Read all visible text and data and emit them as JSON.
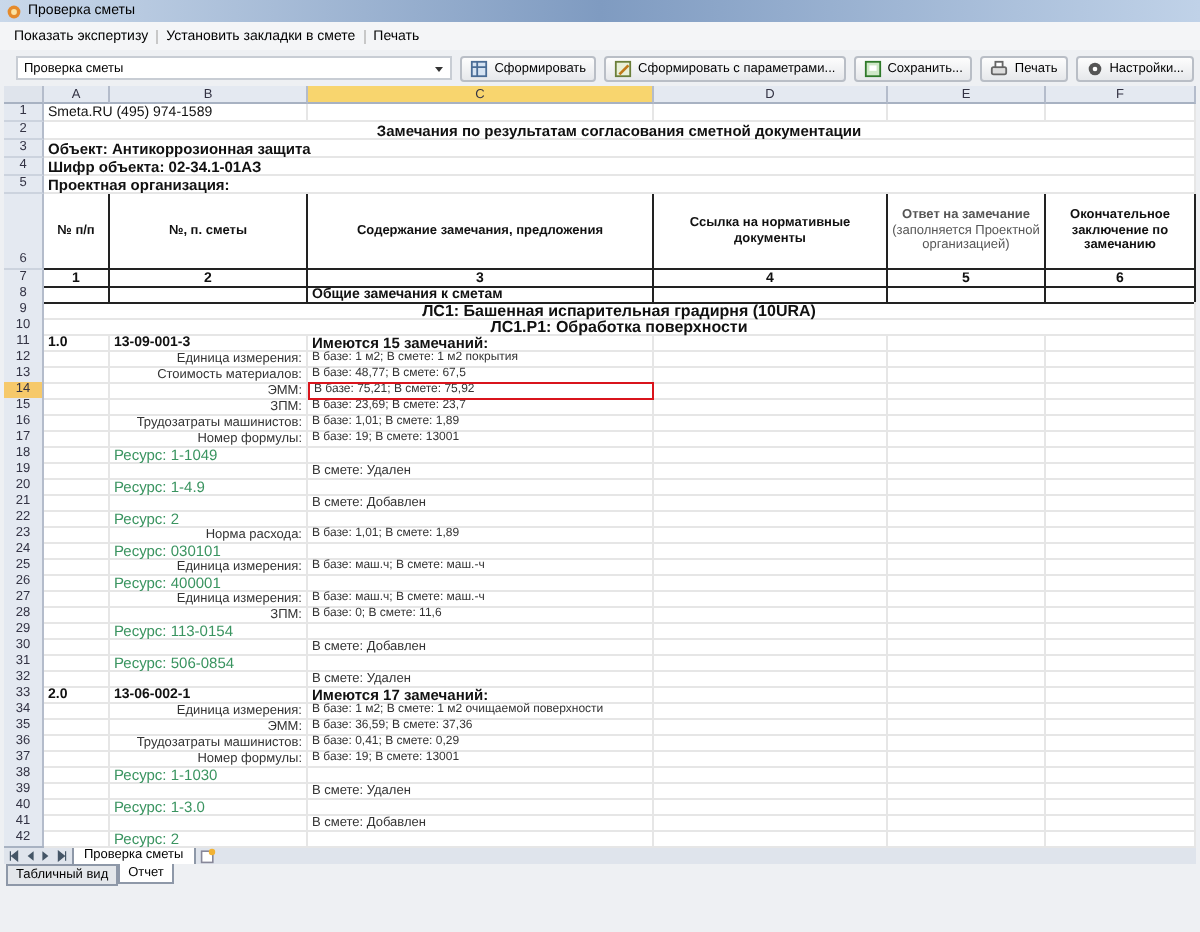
{
  "window": {
    "title": "Проверка сметы"
  },
  "menu": [
    "Показать экспертизу",
    "Установить закладки в смете",
    "Печать"
  ],
  "toolbar": {
    "report_select": "Проверка сметы",
    "buttons": [
      {
        "label": "Сформировать",
        "kind": "table"
      },
      {
        "label": "Сформировать с параметрами...",
        "kind": "params"
      },
      {
        "label": "Сохранить...",
        "kind": "save"
      },
      {
        "label": "Печать",
        "kind": "print"
      },
      {
        "label": "Настройки...",
        "kind": "settings"
      }
    ]
  },
  "columns": [
    {
      "label": "A",
      "selected": false
    },
    {
      "label": "B",
      "selected": false
    },
    {
      "label": "C",
      "selected": true
    },
    {
      "label": "D",
      "selected": false
    },
    {
      "label": "E",
      "selected": false
    },
    {
      "label": "F",
      "selected": false
    }
  ],
  "rows": [
    {
      "num": "1",
      "kind": "info",
      "a": "Smeta.RU  (495) 974-1589",
      "selected": false
    },
    {
      "num": "2",
      "kind": "title",
      "text": "Замечания по результатам согласования  сметной документации",
      "selected": false
    },
    {
      "num": "3",
      "kind": "bold",
      "text": "Объект: Антикоррозионная защита",
      "selected": false
    },
    {
      "num": "4",
      "kind": "bold",
      "text": "Шифр объекта: 02-34.1-01АЗ",
      "selected": false
    },
    {
      "num": "5",
      "kind": "bold",
      "text": "Проектная организация:",
      "selected": false
    },
    {
      "num": "6",
      "kind": "header",
      "cells": [
        "№ п/п",
        "№, п. сметы",
        "Содержание замечания, предложения",
        "Ссылка на нормативные документы",
        "**Ответ на замечание** (заполняется Проектной организацией)",
        "Окончательное заключение по замечанию"
      ],
      "selected": false
    },
    {
      "num": "7",
      "kind": "numbers",
      "cells": [
        "1",
        "2",
        "3",
        "4",
        "5",
        "6"
      ],
      "selected": false
    },
    {
      "num": "8",
      "kind": "general",
      "c": "Общие замечания к сметам",
      "selected": false
    },
    {
      "num": "9",
      "kind": "section",
      "text": "ЛС1: Башенная испарительная градирня (10URA)",
      "selected": false
    },
    {
      "num": "10",
      "kind": "section",
      "text": "ЛС1.Р1: Обработка поверхности",
      "selected": false
    },
    {
      "num": "11",
      "kind": "item",
      "a": "1.0",
      "b": "13-09-001-3",
      "c": "Имеются  15 замечаний:",
      "selected": false
    },
    {
      "num": "12",
      "kind": "detail",
      "b": "Единица измерения:",
      "c": "В базе:  1 м2;   В смете: 1 м2 покрытия",
      "selected": false
    },
    {
      "num": "13",
      "kind": "detail",
      "b": "Стоимость материалов:",
      "c": "В базе:  48,77;   В смете: 67,5",
      "selected": false
    },
    {
      "num": "14",
      "kind": "detail",
      "b": "ЭММ:",
      "c": "В базе:  75,21;   В смете: 75,92",
      "selected": true
    },
    {
      "num": "15",
      "kind": "detail",
      "b": "ЗПМ:",
      "c": "В базе:  23,69;   В смете: 23,7",
      "selected": false
    },
    {
      "num": "16",
      "kind": "detail",
      "b": "Трудозатраты машинистов:",
      "c": "В базе:  1,01;   В смете: 1,89",
      "selected": false
    },
    {
      "num": "17",
      "kind": "detail",
      "b": "Номер формулы:",
      "c": "В базе:  19;   В смете: 13001",
      "selected": false
    },
    {
      "num": "18",
      "kind": "resource",
      "b": "Ресурс: 1-1049",
      "selected": false
    },
    {
      "num": "19",
      "kind": "status",
      "c": "В смете: Удален",
      "selected": false
    },
    {
      "num": "20",
      "kind": "resource",
      "b": "Ресурс: 1-4.9",
      "selected": false
    },
    {
      "num": "21",
      "kind": "status",
      "c": "В смете: Добавлен",
      "selected": false
    },
    {
      "num": "22",
      "kind": "resource",
      "b": "Ресурс: 2",
      "selected": false
    },
    {
      "num": "23",
      "kind": "detail",
      "b": "Норма расхода:",
      "c": "В базе:  1,01;   В смете: 1,89",
      "selected": false
    },
    {
      "num": "24",
      "kind": "resource",
      "b": "Ресурс: 030101",
      "selected": false
    },
    {
      "num": "25",
      "kind": "detail",
      "b": "Единица измерения:",
      "c": "В базе:  маш.ч;   В смете: маш.-ч",
      "selected": false
    },
    {
      "num": "26",
      "kind": "resource",
      "b": "Ресурс: 400001",
      "selected": false
    },
    {
      "num": "27",
      "kind": "detail",
      "b": "Единица измерения:",
      "c": "В базе:  маш.ч;   В смете: маш.-ч",
      "selected": false
    },
    {
      "num": "28",
      "kind": "detail",
      "b": "ЗПМ:",
      "c": "В базе:  0;   В смете: 11,6",
      "selected": false
    },
    {
      "num": "29",
      "kind": "resource",
      "b": "Ресурс: 113-0154",
      "selected": false
    },
    {
      "num": "30",
      "kind": "status",
      "c": "В смете: Добавлен",
      "selected": false
    },
    {
      "num": "31",
      "kind": "resource",
      "b": "Ресурс: 506-0854",
      "selected": false
    },
    {
      "num": "32",
      "kind": "status",
      "c": "В смете: Удален",
      "selected": false
    },
    {
      "num": "33",
      "kind": "item",
      "a": "2.0",
      "b": "13-06-002-1",
      "c": "Имеются  17 замечаний:",
      "selected": false
    },
    {
      "num": "34",
      "kind": "detail",
      "b": "Единица измерения:",
      "c": "В базе:  1 м2;   В смете: 1 м2 очищаемой поверхности",
      "selected": false
    },
    {
      "num": "35",
      "kind": "detail",
      "b": "ЭММ:",
      "c": "В базе:  36,59;   В смете: 37,36",
      "selected": false
    },
    {
      "num": "36",
      "kind": "detail",
      "b": "Трудозатраты машинистов:",
      "c": "В базе:  0,41;   В смете: 0,29",
      "selected": false
    },
    {
      "num": "37",
      "kind": "detail",
      "b": "Номер формулы:",
      "c": "В базе:  19;   В смете: 13001",
      "selected": false
    },
    {
      "num": "38",
      "kind": "resource",
      "b": "Ресурс: 1-1030",
      "selected": false
    },
    {
      "num": "39",
      "kind": "status",
      "c": "В смете: Удален",
      "selected": false
    },
    {
      "num": "40",
      "kind": "resource",
      "b": "Ресурс: 1-3.0",
      "selected": false
    },
    {
      "num": "41",
      "kind": "status",
      "c": "В смете: Добавлен",
      "selected": false
    },
    {
      "num": "42",
      "kind": "resource",
      "b": "Ресурс: 2",
      "selected": false
    }
  ],
  "sheet_tabs": [
    {
      "label": "Проверка сметы",
      "selected": true
    }
  ],
  "view_tabs": [
    {
      "label": "Табличный вид",
      "selected": false
    },
    {
      "label": "Отчет",
      "selected": true
    }
  ]
}
